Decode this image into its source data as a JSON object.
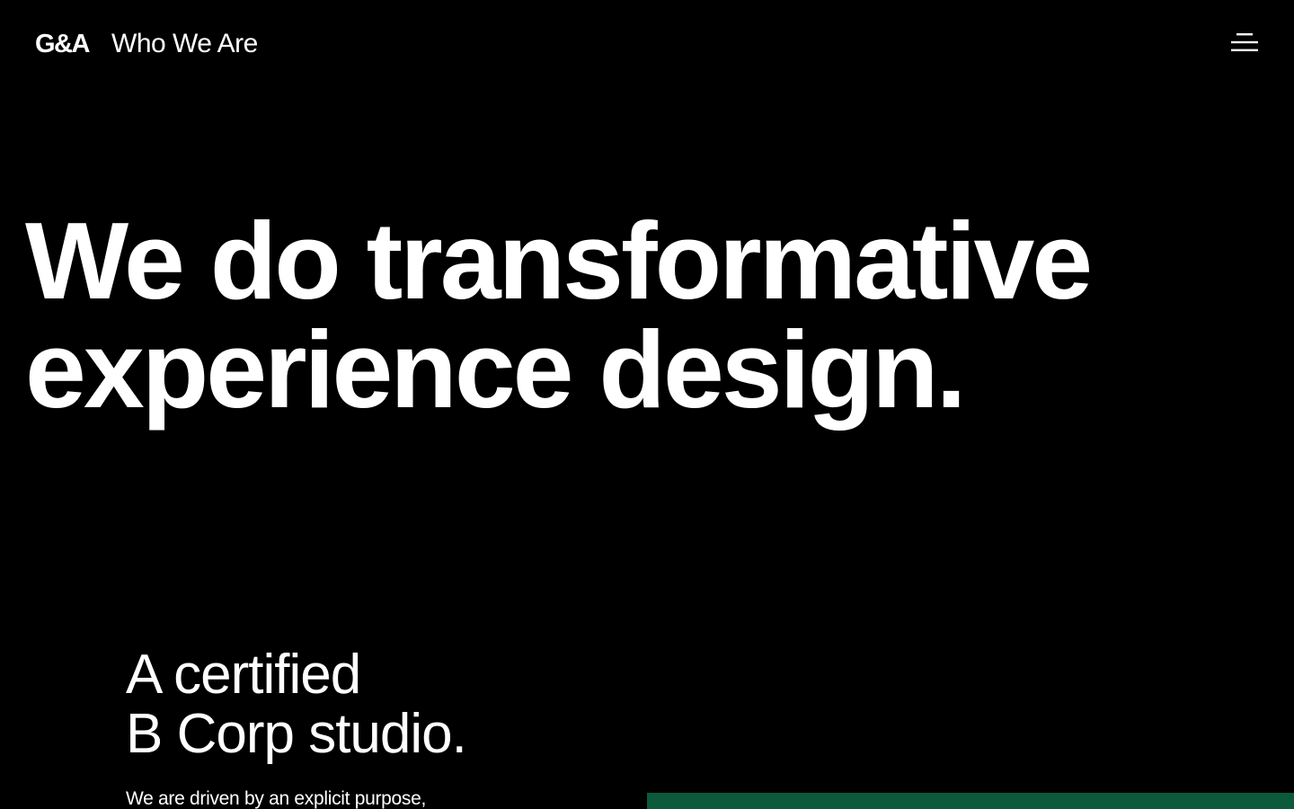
{
  "header": {
    "logo": "G&A",
    "page_label": "Who We Are",
    "menu_icon": "hamburger-menu-icon"
  },
  "hero": {
    "title_line_1": "We do transformative",
    "title_line_2": "experience design."
  },
  "bcorp": {
    "heading_line_1": "A certified",
    "heading_line_2": "B Corp studio.",
    "text": "We are driven by an explicit purpose,"
  },
  "colors": {
    "background": "#000000",
    "text": "#ffffff",
    "accent_green": "#0b5a3c"
  }
}
